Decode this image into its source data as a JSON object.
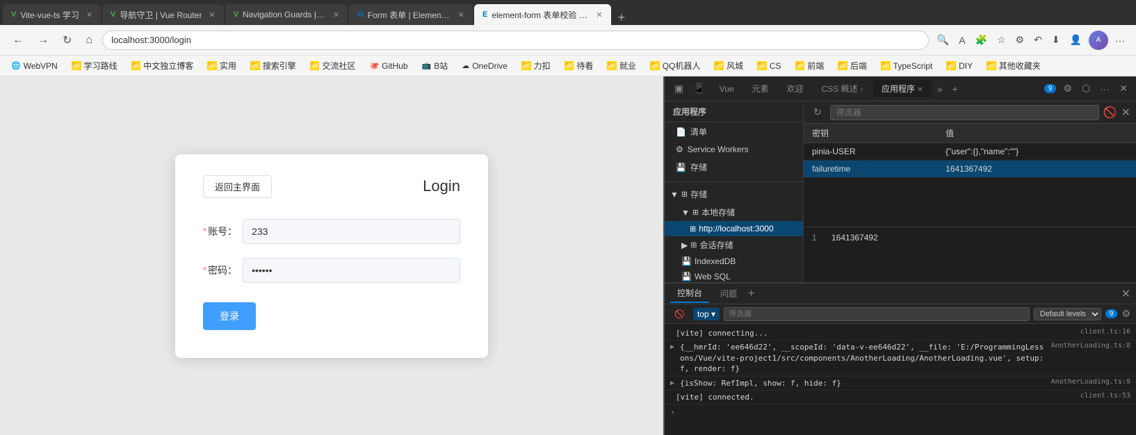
{
  "browser": {
    "tabs": [
      {
        "id": "tab1",
        "label": "Vite-vue-ts 学习",
        "active": false,
        "icon": "V"
      },
      {
        "id": "tab2",
        "label": "导航守卫 | Vue Router",
        "active": false,
        "icon": "V"
      },
      {
        "id": "tab3",
        "label": "Navigation Guards | Vue Router",
        "active": false,
        "icon": "V"
      },
      {
        "id": "tab4",
        "label": "Form 表单 | Element Plus",
        "active": false,
        "icon": "G"
      },
      {
        "id": "tab5",
        "label": "element-form 表单校验 size und...",
        "active": true,
        "icon": "E"
      }
    ],
    "address": "localhost:3000/login",
    "nav": {
      "back": "←",
      "forward": "→",
      "refresh": "↻",
      "home": "⌂"
    }
  },
  "bookmarks": [
    {
      "label": "WebVPN",
      "icon": "🌐"
    },
    {
      "label": "学习路线",
      "icon": "📁"
    },
    {
      "label": "中文独立博客",
      "icon": "📁"
    },
    {
      "label": "实用",
      "icon": "📁"
    },
    {
      "label": "搜索引擎",
      "icon": "📁"
    },
    {
      "label": "交流社区",
      "icon": "📁"
    },
    {
      "label": "GitHub",
      "icon": "🐙"
    },
    {
      "label": "B站",
      "icon": "📺"
    },
    {
      "label": "OneDrive",
      "icon": "☁"
    },
    {
      "label": "力扣",
      "icon": "📁"
    },
    {
      "label": "待看",
      "icon": "📁"
    },
    {
      "label": "就业",
      "icon": "📁"
    },
    {
      "label": "QQ机器人",
      "icon": "📁"
    },
    {
      "label": "风城",
      "icon": "📁"
    },
    {
      "label": "CS",
      "icon": "📁"
    },
    {
      "label": "前端",
      "icon": "📁"
    },
    {
      "label": "后端",
      "icon": "📁"
    },
    {
      "label": "TypeScript",
      "icon": "📁"
    },
    {
      "label": "DIY",
      "icon": "📁"
    },
    {
      "label": "其他收藏夹",
      "icon": "📁"
    }
  ],
  "login_page": {
    "back_button": "返回主界面",
    "title": "Login",
    "username_label": "账号：",
    "username_value": "233",
    "password_label": "密码：",
    "password_value": "••••••",
    "submit_button": "登录",
    "required_mark": "*"
  },
  "devtools": {
    "tabs": [
      "▣",
      "Vue",
      "元素",
      "欢迎",
      "CSS 概述 ↑",
      "应用程序",
      "×",
      "»",
      "+"
    ],
    "active_tab": "应用程序",
    "badge_count": "9",
    "toolbar": {
      "refresh": "↻",
      "filter_placeholder": "筛选器",
      "clear": "✕"
    },
    "storage_table": {
      "headers": [
        "密钥",
        "值"
      ],
      "rows": [
        {
          "key": "pinia-USER",
          "value": "{\"user\":{},\"name\":\"\"}"
        },
        {
          "key": "failuretime",
          "value": "1641367492"
        }
      ],
      "selected_row": 1
    },
    "detail": {
      "line": "1",
      "value": "1641367492"
    },
    "left_panel": {
      "section_label": "应用程序",
      "items": [
        {
          "label": "清单",
          "icon": "📄"
        },
        {
          "label": "Service Workers",
          "icon": "⚙"
        },
        {
          "label": "存储",
          "icon": "💾"
        }
      ],
      "storage": {
        "label": "存储",
        "local_storage": {
          "label": "本地存储",
          "children": [
            {
              "label": "http://localhost:3000",
              "selected": true
            }
          ]
        },
        "session_storage": {
          "label": "会话存储"
        },
        "indexed_db": {
          "label": "IndexedDB"
        },
        "web_sql": {
          "label": "Web SQL"
        }
      }
    },
    "console": {
      "tabs": [
        "控制台",
        "问题"
      ],
      "active_tab": "控制台",
      "filter": {
        "top_label": "top",
        "filter_placeholder": "筛选器",
        "level_label": "Default levels",
        "badge_count": "9"
      },
      "lines": [
        {
          "type": "info",
          "text": "[vite] connecting...",
          "source": "client.ts:16",
          "expandable": false
        },
        {
          "type": "obj",
          "text": "{__hmrId: 'ee646d22', __scopeId: 'data-v-ee646d22', __file: 'E:/ProgrammingLessons/Vue/vite-project1/src/components/AnotherLoading/AnotherLoading.vue', setup: f, render: f}",
          "source": "AnotherLoading.ts:8",
          "expandable": true
        },
        {
          "type": "obj",
          "text": "{isShow: RefImpl, show: f, hide: f}",
          "source": "AnotherLoading.ts:9",
          "expandable": true
        },
        {
          "type": "info",
          "text": "[vite] connected.",
          "source": "client.ts:53",
          "expandable": false
        }
      ],
      "prompt": "›"
    }
  }
}
